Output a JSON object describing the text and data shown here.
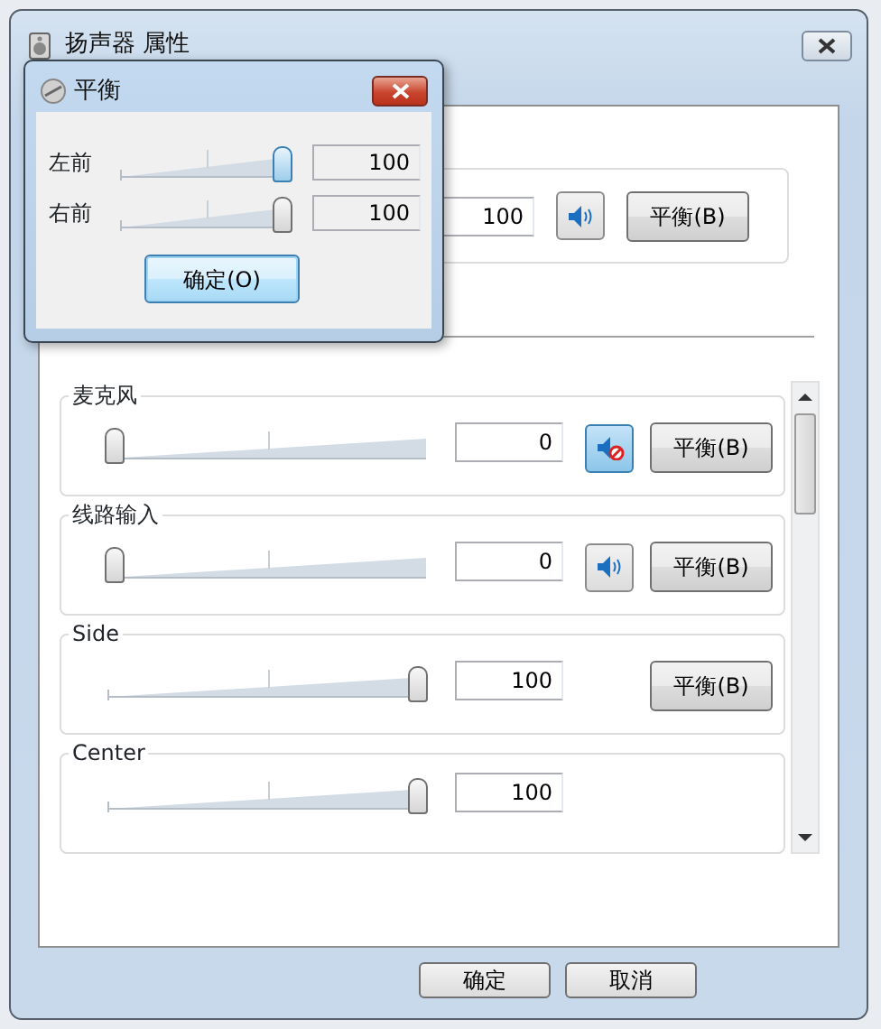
{
  "window": {
    "title": "扬声器 属性"
  },
  "top_channel": {
    "value": "100",
    "muted": false,
    "balance_button": "平衡(B)"
  },
  "channels": [
    {
      "kind": "full",
      "name": "麦克风",
      "level": 0,
      "value": "0",
      "muted": true,
      "balance_button": "平衡(B)"
    },
    {
      "kind": "full",
      "name": "线路输入",
      "level": 0,
      "value": "0",
      "muted": false,
      "balance_button": "平衡(B)"
    },
    {
      "kind": "no-mute",
      "name": "Side",
      "level": 1,
      "value": "100",
      "balance_button": "平衡(B)"
    },
    {
      "kind": "slider-only",
      "name": "Center",
      "level": 1,
      "value": "100"
    }
  ],
  "buttons": [
    "确定",
    "取消"
  ],
  "balance_dialog": {
    "title": "平衡",
    "ok_button": "确定(O)",
    "channels": [
      {
        "label": "左前",
        "level": 1,
        "value": "100",
        "focused": true
      },
      {
        "label": "右前",
        "level": 1,
        "value": "100",
        "focused": false
      }
    ]
  }
}
